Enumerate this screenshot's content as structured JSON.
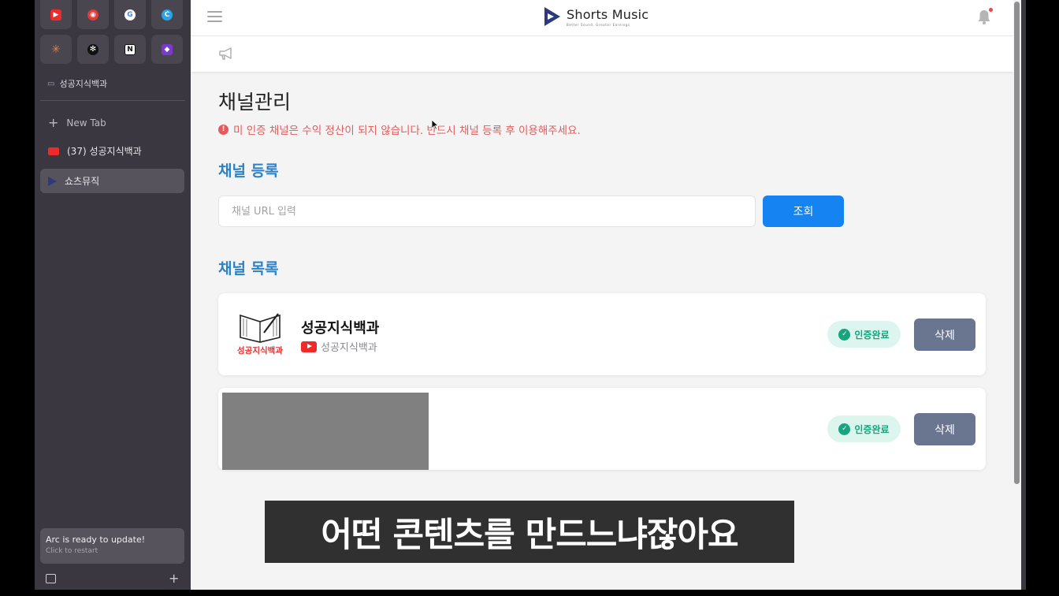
{
  "sidebar": {
    "favorites": [
      {
        "name": "youtube-icon",
        "color": "#ee2a2a",
        "glyph": "▶"
      },
      {
        "name": "app-icon",
        "color": "#e03a3a",
        "glyph": "◉"
      },
      {
        "name": "google-icon",
        "color": "#4285f4",
        "glyph": "G"
      },
      {
        "name": "canva-icon",
        "color": "#2aa4e8",
        "glyph": "C"
      },
      {
        "name": "claude-icon",
        "color": "#d97a4a",
        "glyph": "✳"
      },
      {
        "name": "chatgpt-icon",
        "color": "#222222",
        "glyph": "✻"
      },
      {
        "name": "notion-icon",
        "color": "#ffffff",
        "glyph": "N"
      },
      {
        "name": "app2-icon",
        "color": "#8a4ad9",
        "glyph": "◆"
      }
    ],
    "pinned_label": "성공지식백과",
    "new_tab_label": "New Tab",
    "tabs": [
      {
        "label": "(37) 성공지식백과"
      },
      {
        "label": "쇼츠뮤직"
      }
    ],
    "update_title": "Arc is ready to update!",
    "update_sub": "Click to restart"
  },
  "header": {
    "logo_text": "Shorts Music",
    "logo_tagline": "Better Sound, Greater Earnings"
  },
  "main": {
    "title": "채널관리",
    "warning": "미 인증 채널은 수익 정산이 되지 않습니다. 반드시 채널 등록 후 이용해주세요.",
    "register_heading": "채널 등록",
    "url_placeholder": "채널 URL 입력",
    "search_button": "조회",
    "list_heading": "채널 목록",
    "channels": [
      {
        "name": "성공지식백과",
        "youtube_name": "성공지식백과",
        "thumb_text": "성공지식백과",
        "status": "인증완료",
        "delete_label": "삭제"
      },
      {
        "status": "인증완료",
        "delete_label": "삭제"
      }
    ]
  },
  "subtitle": "어떤 콘텐츠를 만드느냐잖아요",
  "colors": {
    "accent": "#1584f2",
    "heading_blue": "#2b82c9",
    "warning_red": "#e25c5c",
    "verified_green": "#17a57d",
    "delete_gray": "#6a7590"
  }
}
